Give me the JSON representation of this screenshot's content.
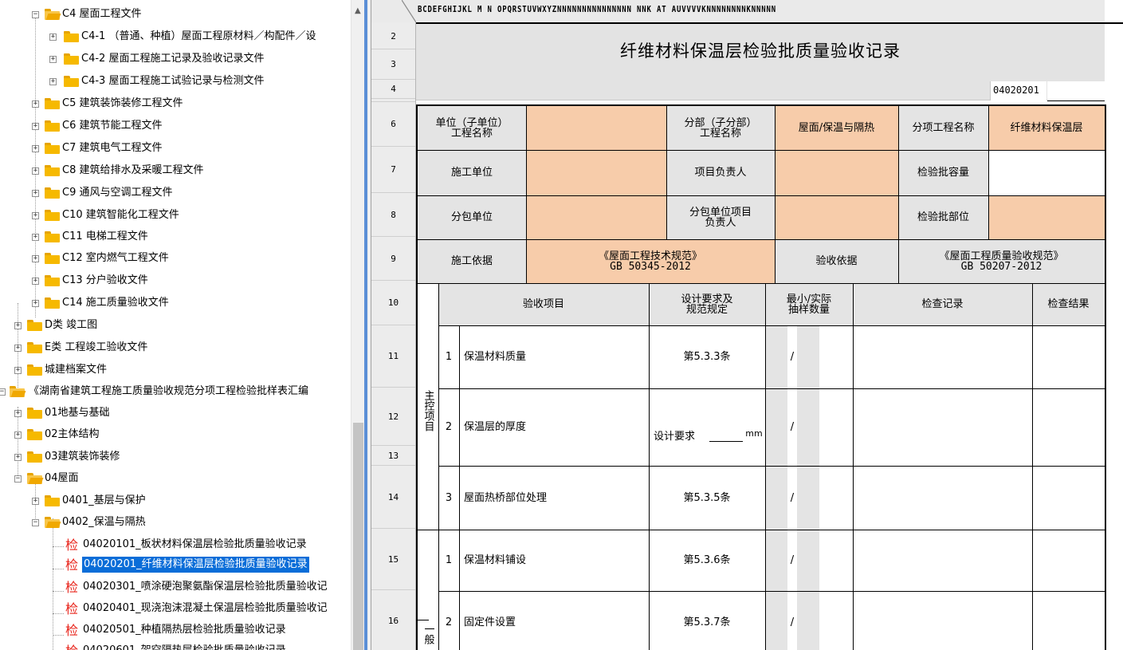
{
  "tree": {
    "items": [
      {
        "label": "C4 屋面工程文件",
        "type": "folder-open"
      },
      {
        "label": "C4-1 （普通、种植）屋面工程原材料／构配件／设",
        "type": "folder"
      },
      {
        "label": "C4-2 屋面工程施工记录及验收记录文件",
        "type": "folder"
      },
      {
        "label": "C4-3 屋面工程施工试验记录与检测文件",
        "type": "folder"
      },
      {
        "label": "C5 建筑装饰装修工程文件",
        "type": "folder"
      },
      {
        "label": "C6 建筑节能工程文件",
        "type": "folder"
      },
      {
        "label": "C7 建筑电气工程文件",
        "type": "folder"
      },
      {
        "label": "C8 建筑给排水及采暖工程文件",
        "type": "folder"
      },
      {
        "label": "C9 通风与空调工程文件",
        "type": "folder"
      },
      {
        "label": "C10 建筑智能化工程文件",
        "type": "folder"
      },
      {
        "label": "C11 电梯工程文件",
        "type": "folder"
      },
      {
        "label": "C12 室内燃气工程文件",
        "type": "folder"
      },
      {
        "label": "C13 分户验收文件",
        "type": "folder"
      },
      {
        "label": "C14 施工质量验收文件",
        "type": "folder"
      },
      {
        "label": "D类 竣工图",
        "type": "folder"
      },
      {
        "label": "E类 工程竣工验收文件",
        "type": "folder"
      },
      {
        "label": "城建档案文件",
        "type": "folder"
      },
      {
        "label": "《湖南省建筑工程施工质量验收规范分项工程检验批样表汇编",
        "type": "folder-open"
      },
      {
        "label": "01地基与基础",
        "type": "folder"
      },
      {
        "label": "02主体结构",
        "type": "folder"
      },
      {
        "label": "03建筑装饰装修",
        "type": "folder"
      },
      {
        "label": "04屋面",
        "type": "folder-open"
      },
      {
        "label": "0401_基层与保护",
        "type": "folder"
      },
      {
        "label": "0402_保温与隔热",
        "type": "folder-open"
      },
      {
        "label": "04020101_板状材料保温层检验批质量验收记录",
        "type": "doc"
      },
      {
        "label": "04020201_纤维材料保温层检验批质量验收记录",
        "type": "doc",
        "selected": true
      },
      {
        "label": "04020301_喷涂硬泡聚氨酯保温层检验批质量验收记",
        "type": "doc"
      },
      {
        "label": "04020401_现浇泡沫混凝土保温层检验批质量验收记",
        "type": "doc"
      },
      {
        "label": "04020501_种植隔热层检验批质量验收记录",
        "type": "doc"
      },
      {
        "label": "04020601_架空隔热层检验批质量验收记录",
        "type": "doc"
      }
    ],
    "doc_glyph": "检"
  },
  "sheet": {
    "column_letters": "BCDEFGHIJKL M N OPQRSTUVWXYZNNNNNNNNNNNNNNN NNK  AT  AUVVVVKNNNNNNNNKNNNNN",
    "rows": [
      "2",
      "3",
      "4",
      "6",
      "7",
      "8",
      "9",
      "10",
      "11",
      "12",
      "13",
      "14",
      "15",
      "16"
    ],
    "title": "纤维材料保温层检验批质量验收记录",
    "code": "04020201",
    "form": {
      "unit_label_1": "单位（子单位）",
      "unit_label_2": "工程名称",
      "sub_label_1": "分部（子分部）",
      "sub_label_2": "工程名称",
      "sub_value": "屋面/保温与隔热",
      "item_label": "分项工程名称",
      "item_value": "纤维材料保温层",
      "constr_unit": "施工单位",
      "pm_label": "项目负责人",
      "batch_cap": "检验批容量",
      "subcontract": "分包单位",
      "sub_pm_1": "分包单位项目",
      "sub_pm_2": "负责人",
      "batch_part": "检验批部位",
      "basis_label": "施工依据",
      "basis_1": "《屋面工程技术规范》",
      "basis_2": "GB 50345-2012",
      "accept_label": "验收依据",
      "accept_1": "《屋面工程质量验收规范》",
      "accept_2": "GB 50207-2012",
      "h_item": "验收项目",
      "h_req_1": "设计要求及",
      "h_req_2": "规范规定",
      "h_min_1": "最小/实际",
      "h_min_2": "抽样数量",
      "h_rec": "检查记录",
      "h_res": "检查结果",
      "main_group": "主控项目",
      "gen_group": "一般",
      "items": [
        {
          "no": "1",
          "name": "保温材料质量",
          "req": "第5.3.3条",
          "slash": "/"
        },
        {
          "no": "2",
          "name": "保温层的厚度",
          "req": "设计要求",
          "unit": "mm",
          "slash": "/"
        },
        {
          "no": "3",
          "name": "屋面热桥部位处理",
          "req": "第5.3.5条",
          "slash": "/"
        },
        {
          "no": "1",
          "name": "保温材料铺设",
          "req": "第5.3.6条",
          "slash": "/"
        },
        {
          "no": "2",
          "name": "固定件设置",
          "req": "第5.3.7条",
          "slash": "/"
        }
      ]
    }
  }
}
